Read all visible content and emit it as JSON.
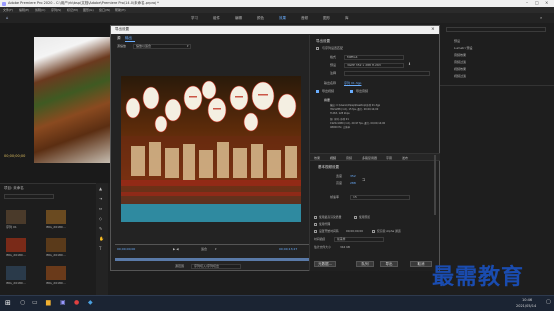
{
  "app": {
    "title": "Adobe Premiere Pro 2020 - C:\\用户\\rb\\bsp\\文档\\Adobe\\Premiere Pro\\14.0\\未命名.prproj *",
    "menus": [
      "文件(F)",
      "编辑(E)",
      "剪辑(C)",
      "序列(S)",
      "标记(M)",
      "图形(G)",
      "窗口(W)",
      "帮助(H)"
    ],
    "workspaces": [
      "学习",
      "组件",
      "编辑",
      "颜色",
      "效果",
      "音频",
      "图形",
      "库"
    ],
    "active_workspace": "效果"
  },
  "dialog": {
    "title": "导出设置",
    "tabs": [
      "源",
      "输出"
    ],
    "source_scaling_label": "源缩放",
    "source_scaling_value": "缩放以适合",
    "timecode_start": "00;00;00;00",
    "timecode_end": "00;00;13;27",
    "fit_label": "适合",
    "range_label": "源范围",
    "range_value": "序列切入/序列切出",
    "export_settings": {
      "header": "导出设置",
      "match_sequence_label": "与序列设置匹配",
      "format_label": "格式",
      "format_value": "MPEG4",
      "preset_label": "预设",
      "preset_value": "3GPP 352 x 288 H.263",
      "comment_label": "注释",
      "output_name_label": "输出名称",
      "output_name_value": "序列 01.3gp",
      "export_video_label": "导出视频",
      "export_audio_label": "导出音频",
      "summary_label": "摘要",
      "summary_lines": [
        "输出: C:\\Users\\rb\\bsp\\Desktop\\序列 01.3gp",
        "352x288 (1.0), 15 fps, 逐行, 00;00;14;00",
        "H.263, 128 kbps",
        "源: 序列, 序列 01",
        "1920x1080 (1.0), 29.97 fps, 逐行, 00;00;14;00",
        "48000 Hz, 立体声"
      ]
    },
    "settings_tabs": [
      "效果",
      "视频",
      "音频",
      "多路复用器",
      "字幕",
      "发布"
    ],
    "basic_video_header": "基本视频设置",
    "width_label": "宽度",
    "width_value": "352",
    "height_label": "高度",
    "height_value": "288",
    "frame_rate_label": "帧速率",
    "frame_rate_value": "15",
    "options": [
      "使用最高渲染质量",
      "使用预览",
      "设置开始时间码",
      "仅渲染 Alpha 通道",
      "使用代理"
    ],
    "start_timecode_value": "00;00;00;00",
    "interpolation_label": "时间插值",
    "interpolation_value": "帧采样",
    "file_size_label": "估计文件大小",
    "file_size_value": "344 KB",
    "buttons": {
      "metadata": "元数据...",
      "queue": "队列",
      "export": "导出",
      "cancel": "取消"
    }
  },
  "project": {
    "title": "项目: 未命名",
    "items": [
      "序列 01",
      "IMG_20180...",
      "IMG_20180...",
      "IMG_20180...",
      "IMG_20180...",
      "IMG_20180..."
    ]
  },
  "right_panel": {
    "items": [
      "预设",
      "Lumetri 预设",
      "音频效果",
      "音频过渡",
      "视频效果",
      "视频过渡"
    ]
  },
  "timecode_left": "00;00;00;00",
  "watermark": "最需教育",
  "taskbar": {
    "time": "10:46",
    "date": "2021/05/14"
  }
}
